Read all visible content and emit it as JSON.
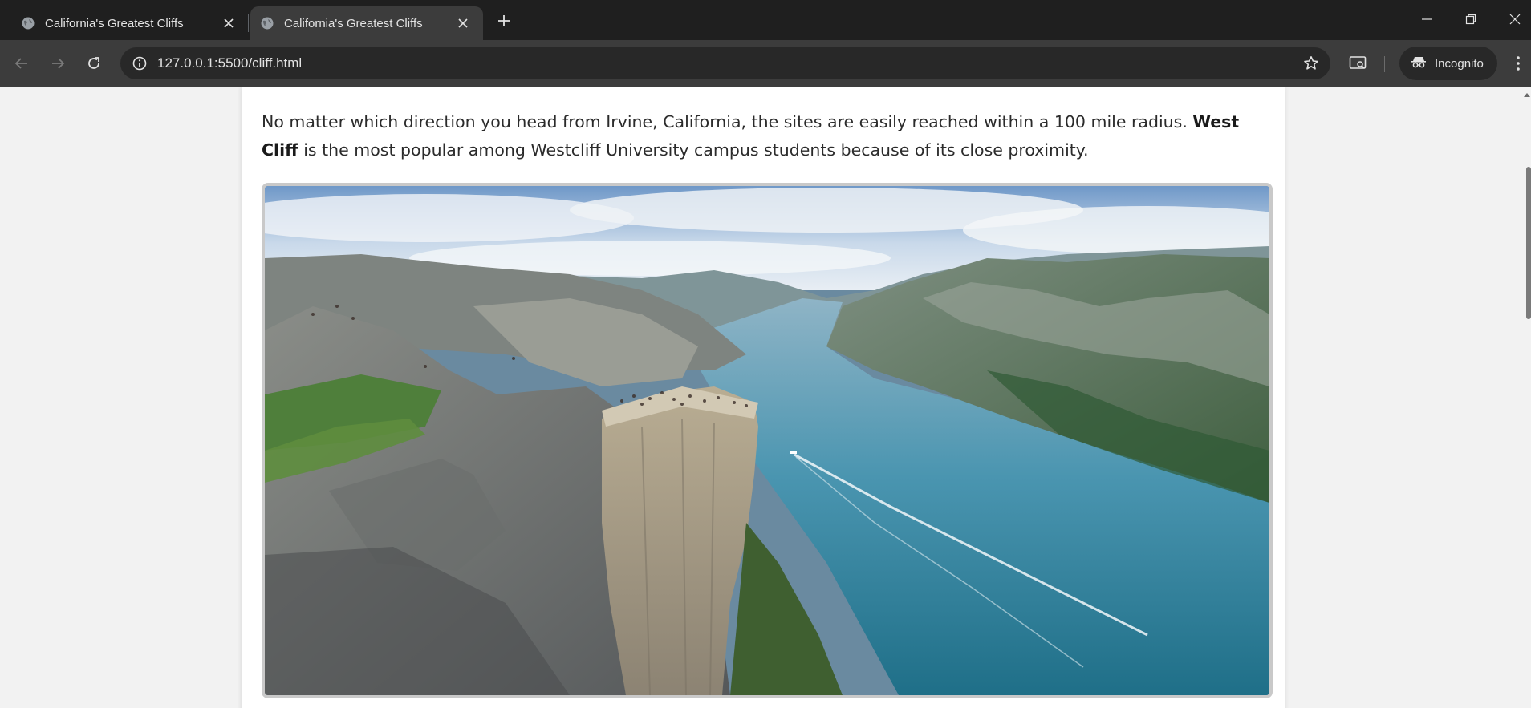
{
  "browser": {
    "tabs": [
      {
        "title": "California's Greatest Cliffs",
        "active": false
      },
      {
        "title": "California's Greatest Cliffs",
        "active": true
      }
    ],
    "address_bar": {
      "url": "127.0.0.1:5500/cliff.html"
    },
    "profile_chip": {
      "label": "Incognito"
    },
    "icons": {
      "favicon": "globe-icon",
      "close": "close-icon",
      "new_tab": "plus-icon",
      "back": "arrow-left-icon",
      "forward": "arrow-right-icon",
      "reload": "reload-icon",
      "site_info": "info-icon",
      "bookmark": "star-icon",
      "cast": "cast-icon",
      "incognito": "incognito-icon",
      "menu": "kebab-menu-icon",
      "minimize": "minimize-icon",
      "restore": "restore-icon",
      "window_close": "window-close-icon"
    }
  },
  "page": {
    "intro": {
      "text_before": "No matter which direction you head from Irvine, California, the sites are easily reached within a 100 mile radius. ",
      "bold": "West Cliff",
      "text_after": " is the most popular among Westcliff University campus students because of its close proximity."
    }
  },
  "colors": {
    "tab_strip": "#1f1f1f",
    "toolbar": "#3c3c3c",
    "omnibox": "#282828",
    "page_background": "#f2f2f2",
    "card": "#ffffff",
    "photo_border": "#c9c9c9",
    "fjord_water": "#3f8ba6"
  }
}
